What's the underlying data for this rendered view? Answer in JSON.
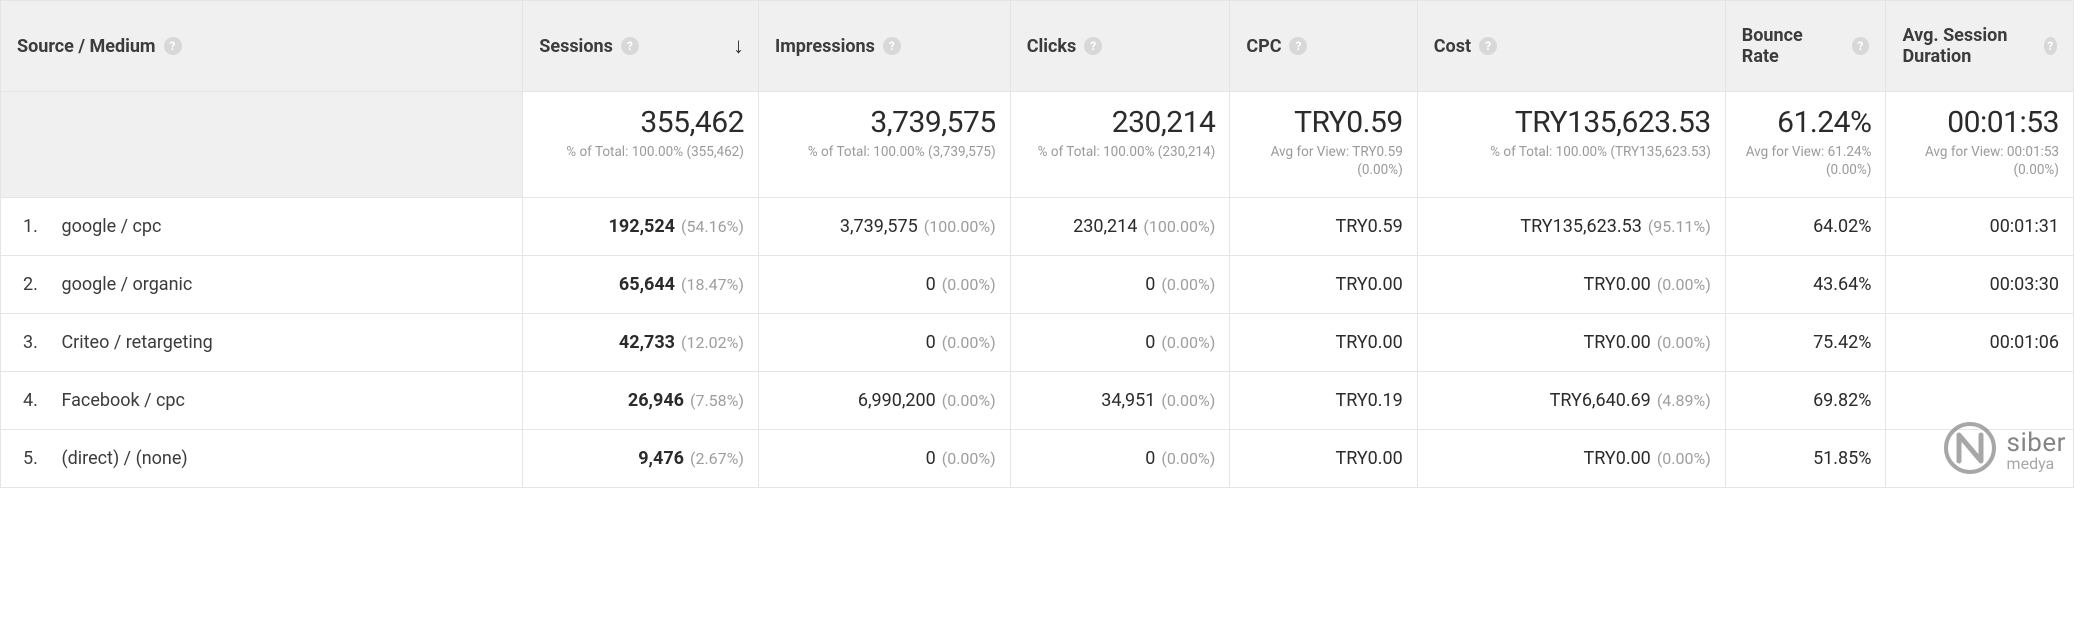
{
  "columns": {
    "source": {
      "label": "Source / Medium"
    },
    "sessions": {
      "label": "Sessions"
    },
    "impressions": {
      "label": "Impressions"
    },
    "clicks": {
      "label": "Clicks"
    },
    "cpc": {
      "label": "CPC"
    },
    "cost": {
      "label": "Cost"
    },
    "bounce": {
      "label": "Bounce Rate"
    },
    "avg": {
      "label": "Avg. Session Duration"
    }
  },
  "totals": {
    "sessions": {
      "value": "355,462",
      "sub": "% of Total: 100.00% (355,462)"
    },
    "impressions": {
      "value": "3,739,575",
      "sub": "% of Total: 100.00% (3,739,575)"
    },
    "clicks": {
      "value": "230,214",
      "sub": "% of Total: 100.00% (230,214)"
    },
    "cpc": {
      "value": "TRY0.59",
      "sub": "Avg for View: TRY0.59 (0.00%)"
    },
    "cost": {
      "value": "TRY135,623.53",
      "sub": "% of Total: 100.00% (TRY135,623.53)"
    },
    "bounce": {
      "value": "61.24%",
      "sub": "Avg for View: 61.24% (0.00%)"
    },
    "avg": {
      "value": "00:01:53",
      "sub": "Avg for View: 00:01:53 (0.00%)"
    }
  },
  "rows": [
    {
      "n": "1.",
      "source": "google / cpc",
      "sessions": {
        "v": "192,524",
        "p": "(54.16%)"
      },
      "impressions": {
        "v": "3,739,575",
        "p": "(100.00%)"
      },
      "clicks": {
        "v": "230,214",
        "p": "(100.00%)"
      },
      "cpc": {
        "v": "TRY0.59"
      },
      "cost": {
        "v": "TRY135,623.53",
        "p": "(95.11%)"
      },
      "bounce": {
        "v": "64.02%"
      },
      "avg": {
        "v": "00:01:31"
      }
    },
    {
      "n": "2.",
      "source": "google / organic",
      "sessions": {
        "v": "65,644",
        "p": "(18.47%)"
      },
      "impressions": {
        "v": "0",
        "p": "(0.00%)"
      },
      "clicks": {
        "v": "0",
        "p": "(0.00%)"
      },
      "cpc": {
        "v": "TRY0.00"
      },
      "cost": {
        "v": "TRY0.00",
        "p": "(0.00%)"
      },
      "bounce": {
        "v": "43.64%"
      },
      "avg": {
        "v": "00:03:30"
      }
    },
    {
      "n": "3.",
      "source": "Criteo / retargeting",
      "sessions": {
        "v": "42,733",
        "p": "(12.02%)"
      },
      "impressions": {
        "v": "0",
        "p": "(0.00%)"
      },
      "clicks": {
        "v": "0",
        "p": "(0.00%)"
      },
      "cpc": {
        "v": "TRY0.00"
      },
      "cost": {
        "v": "TRY0.00",
        "p": "(0.00%)"
      },
      "bounce": {
        "v": "75.42%"
      },
      "avg": {
        "v": "00:01:06"
      }
    },
    {
      "n": "4.",
      "source": "Facebook / cpc",
      "sessions": {
        "v": "26,946",
        "p": "(7.58%)"
      },
      "impressions": {
        "v": "6,990,200",
        "p": "(0.00%)"
      },
      "clicks": {
        "v": "34,951",
        "p": "(0.00%)"
      },
      "cpc": {
        "v": "TRY0.19"
      },
      "cost": {
        "v": "TRY6,640.69",
        "p": "(4.89%)"
      },
      "bounce": {
        "v": "69.82%"
      },
      "avg": {
        "v": ""
      }
    },
    {
      "n": "5.",
      "source": "(direct) / (none)",
      "sessions": {
        "v": "9,476",
        "p": "(2.67%)"
      },
      "impressions": {
        "v": "0",
        "p": "(0.00%)"
      },
      "clicks": {
        "v": "0",
        "p": "(0.00%)"
      },
      "cpc": {
        "v": "TRY0.00"
      },
      "cost": {
        "v": "TRY0.00",
        "p": "(0.00%)"
      },
      "bounce": {
        "v": "51.85%"
      },
      "avg": {
        "v": ""
      }
    }
  ],
  "watermark": {
    "line1": "siber",
    "line2": "medya"
  }
}
